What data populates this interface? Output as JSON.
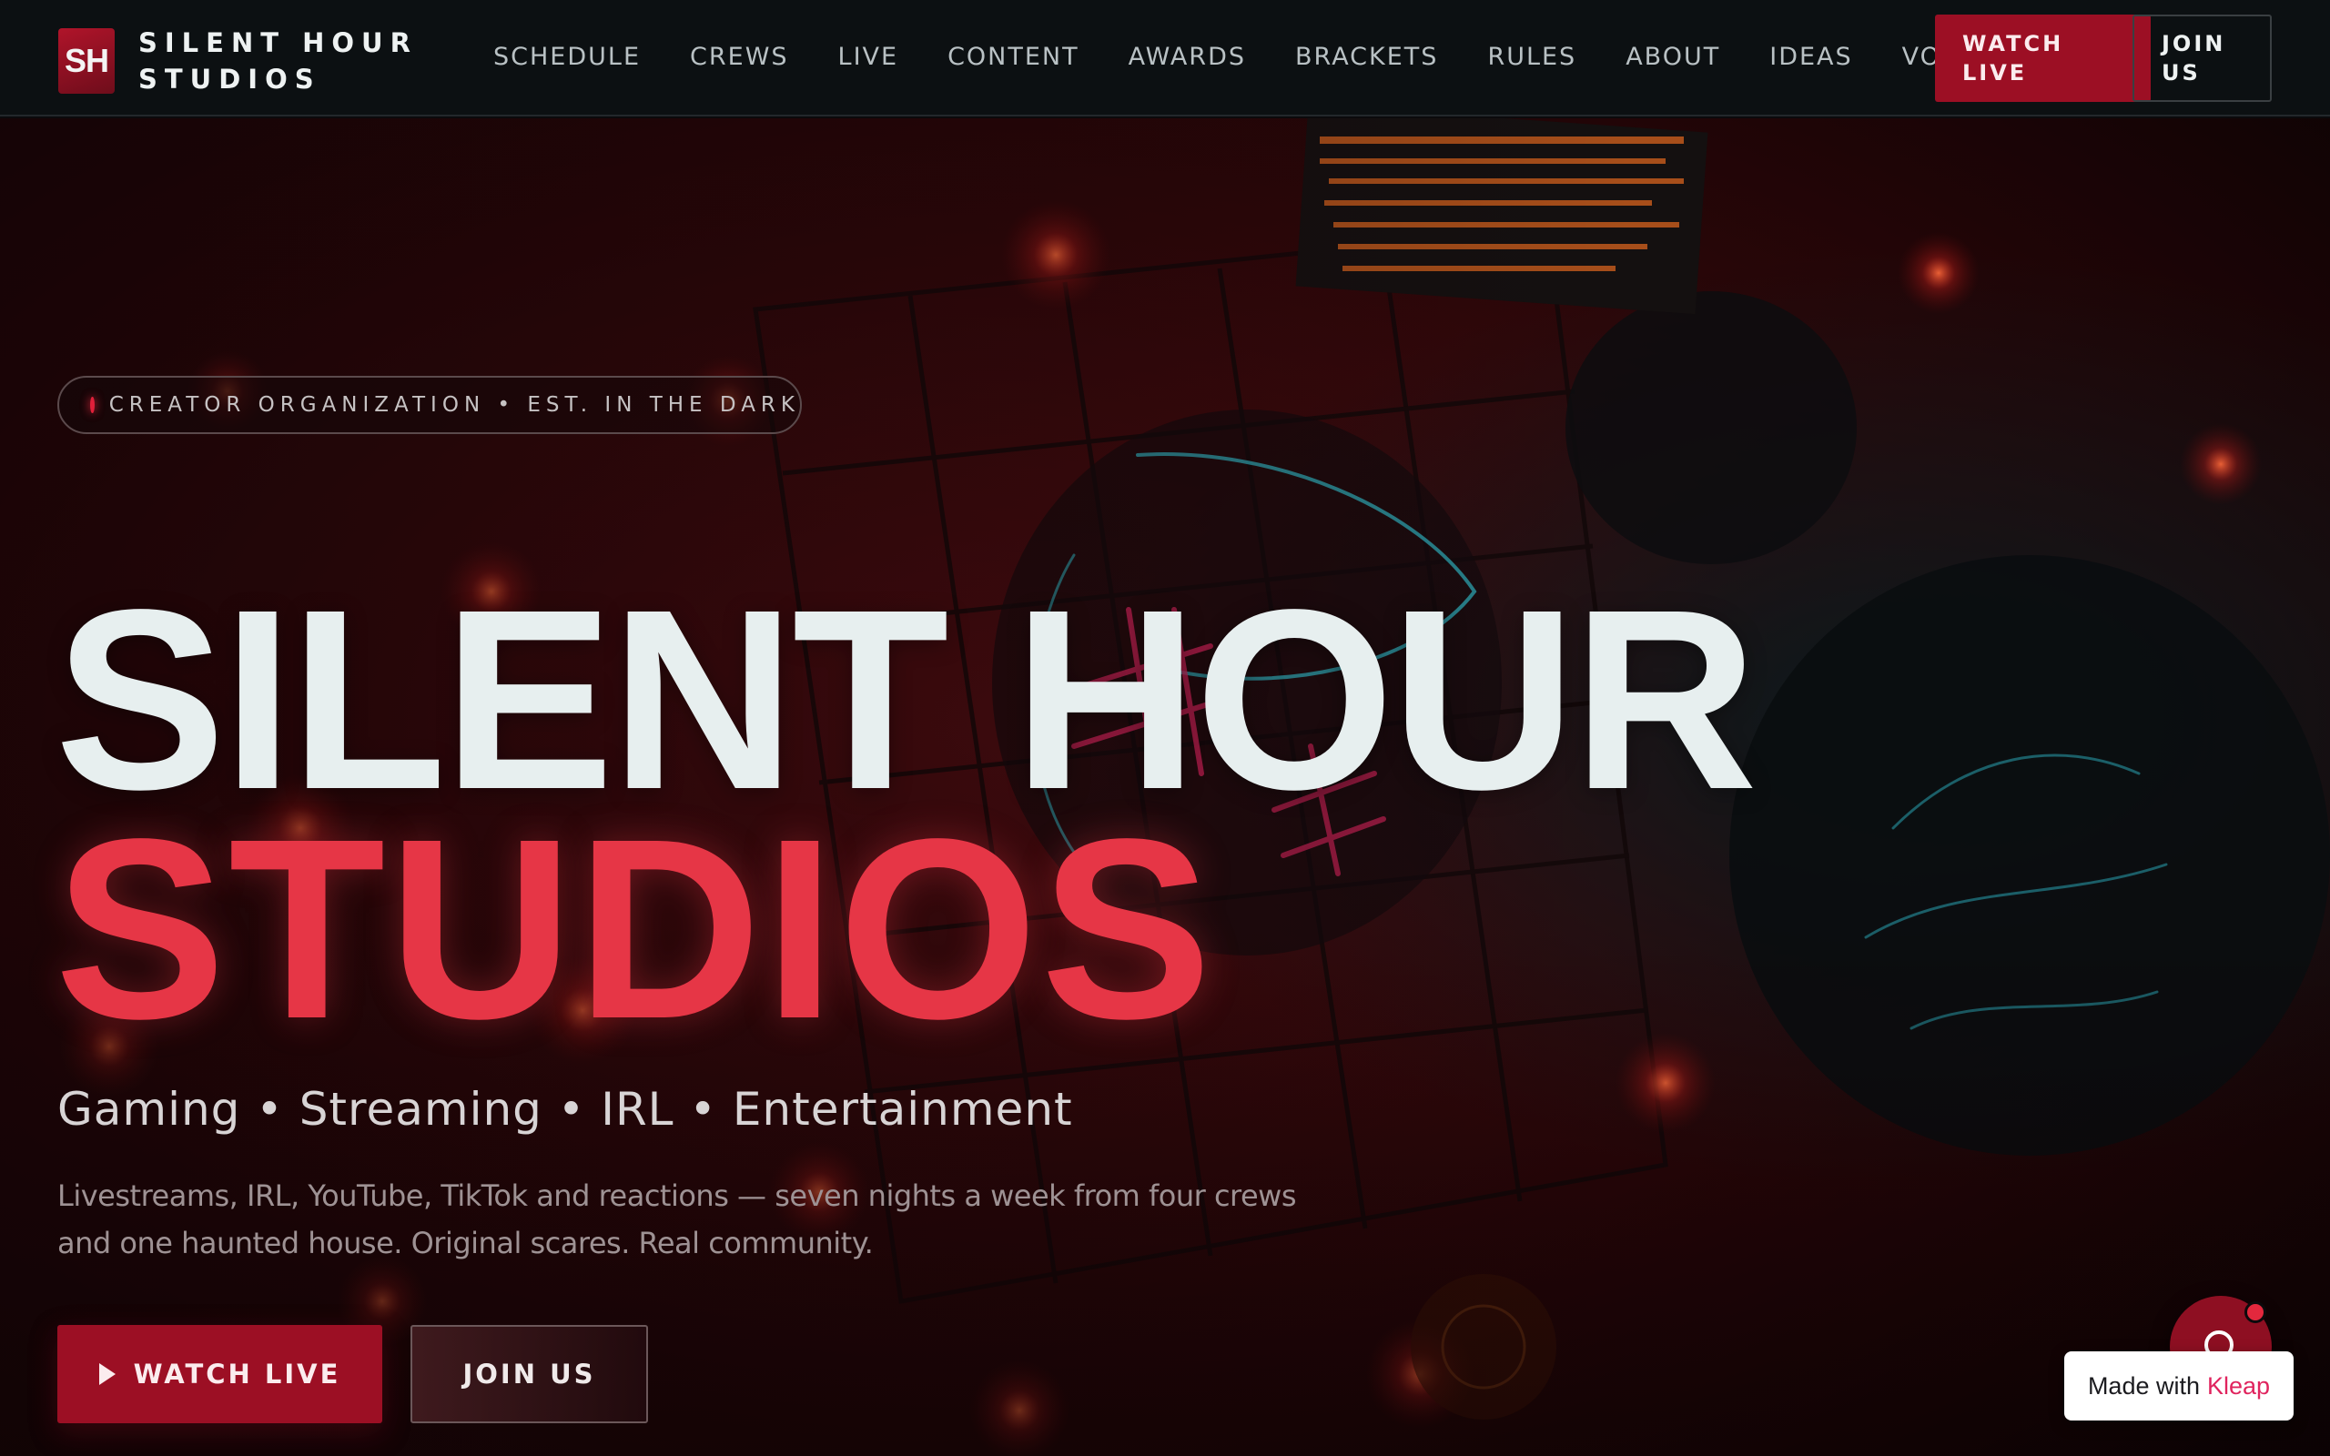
{
  "brand": {
    "logo_text": "SH",
    "name_line1": "SILENT HOUR",
    "name_line2": "STUDIOS"
  },
  "nav": {
    "items": [
      "SCHEDULE",
      "CREWS",
      "LIVE",
      "CONTENT",
      "AWARDS",
      "BRACKETS",
      "RULES",
      "ABOUT",
      "IDEAS",
      "VOTES"
    ]
  },
  "header_buttons": {
    "watch_live_line1": "WATCH",
    "watch_live_line2": "LIVE",
    "join_us_line1": "JOIN",
    "join_us_line2": "US"
  },
  "hero": {
    "badge": "CREATOR ORGANIZATION  •  EST. IN THE DARK",
    "title_line1": "SILENT HOUR",
    "title_line2": "STUDIOS",
    "tagline": "Gaming • Streaming • IRL • Entertainment",
    "description": "Livestreams, IRL, YouTube, TikTok and reactions — seven nights a week from four crews and one haunted house. Original scares. Real community.",
    "cta_watch": "WATCH LIVE",
    "cta_join": "JOIN US"
  },
  "widget": {
    "made_with_prefix": "Made with",
    "made_with_brand": "Kleap"
  },
  "colors": {
    "accent_red": "#9c0f24",
    "title_red": "#e63646",
    "title_white": "#e7efef",
    "header_bg": "#0c1012",
    "kleap_pink": "#e0245e"
  },
  "icons": {
    "play": "play-icon",
    "chat": "chat-bubble-icon",
    "status_dot": "live-dot-icon"
  }
}
